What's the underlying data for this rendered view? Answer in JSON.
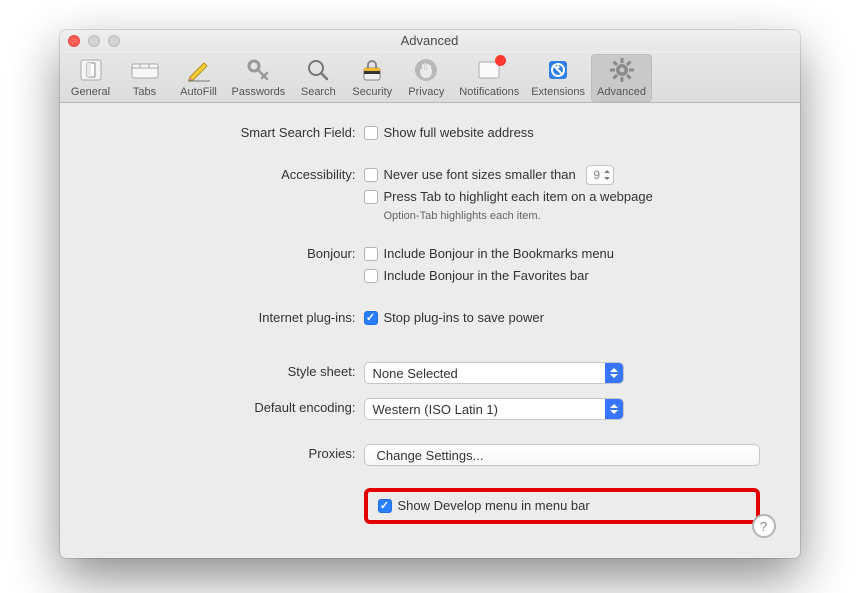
{
  "window": {
    "title": "Advanced"
  },
  "toolbar": {
    "items": [
      {
        "label": "General"
      },
      {
        "label": "Tabs"
      },
      {
        "label": "AutoFill"
      },
      {
        "label": "Passwords"
      },
      {
        "label": "Search"
      },
      {
        "label": "Security"
      },
      {
        "label": "Privacy"
      },
      {
        "label": "Notifications"
      },
      {
        "label": "Extensions"
      },
      {
        "label": "Advanced"
      }
    ],
    "selected_index": 9
  },
  "sections": {
    "smart_search": {
      "label": "Smart Search Field:",
      "show_full_address_label": "Show full website address",
      "show_full_address_checked": false
    },
    "accessibility": {
      "label": "Accessibility:",
      "min_font_label": "Never use font sizes smaller than",
      "min_font_checked": false,
      "min_font_value": "9",
      "tab_highlight_label": "Press Tab to highlight each item on a webpage",
      "tab_highlight_checked": false,
      "tab_highlight_hint": "Option-Tab highlights each item."
    },
    "bonjour": {
      "label": "Bonjour:",
      "bookmarks_label": "Include Bonjour in the Bookmarks menu",
      "bookmarks_checked": false,
      "favorites_label": "Include Bonjour in the Favorites bar",
      "favorites_checked": false
    },
    "plugins": {
      "label": "Internet plug-ins:",
      "stop_label": "Stop plug-ins to save power",
      "stop_checked": true
    },
    "stylesheet": {
      "label": "Style sheet:",
      "value": "None Selected"
    },
    "encoding": {
      "label": "Default encoding:",
      "value": "Western (ISO Latin 1)"
    },
    "proxies": {
      "label": "Proxies:",
      "button": "Change Settings..."
    },
    "develop": {
      "label": "Show Develop menu in menu bar",
      "checked": true
    }
  },
  "help": "?"
}
